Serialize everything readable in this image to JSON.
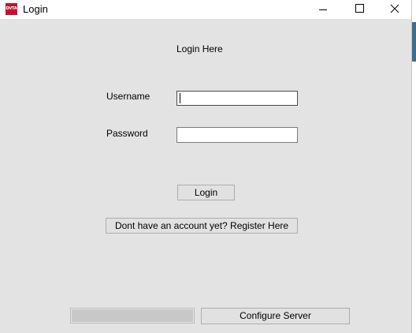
{
  "window": {
    "title": "Login",
    "app_icon_text": "DVTA",
    "app_icon_color": "#c8102e"
  },
  "controls": {
    "minimize": "minimize-icon",
    "maximize": "maximize-icon",
    "close": "close-icon"
  },
  "form": {
    "heading": "Login Here",
    "username_label": "Username",
    "username_value": "",
    "password_label": "Password",
    "password_value": "",
    "login_button": "Login",
    "register_button": "Dont have an account yet? Register Here"
  },
  "footer": {
    "progress": 1.0,
    "configure_button": "Configure Server"
  }
}
